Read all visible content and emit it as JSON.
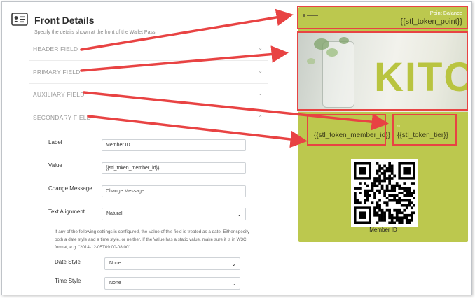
{
  "form": {
    "title": "Front Details",
    "subtitle": "Specify the details shown at the front of the Wallet Pass",
    "sections": [
      {
        "label": "HEADER FIELD",
        "state": "collapsed"
      },
      {
        "label": "PRIMARY FIELD",
        "state": "collapsed"
      },
      {
        "label": "AUXILIARY FIELD",
        "state": "collapsed"
      },
      {
        "label": "SECONDARY FIELD",
        "state": "expanded"
      }
    ],
    "secondary": {
      "label_label": "Label",
      "label_value": "Member ID",
      "value_label": "Value",
      "value_value": "{{stl_token_member_id}}",
      "change_message_label": "Change Message",
      "change_message_placeholder": "Change Message",
      "text_alignment_label": "Text Alignment",
      "text_alignment_value": "Natural",
      "note": "If any of the following settings is configured, the Value of this field is treated as a date. Either specify both a date style and a time style, or neither. If the Value has a static value, make sure it is in W3C format, e.g. \"2014-12-05T09:00-08:00\"",
      "date_style_label": "Date Style",
      "date_style_value": "None",
      "time_style_label": "Time Style",
      "time_style_value": "None"
    }
  },
  "pass": {
    "header_label": "Point Balance",
    "header_value": "{{stl_token_point}}",
    "strip_word": "KITC",
    "secondary_fields": [
      {
        "value": "{{stl_token_member_id}}"
      },
      {
        "label": "ier",
        "value": "{{stl_token_tier}}"
      }
    ],
    "barcode_caption": "Member ID"
  },
  "colors": {
    "pass_background": "#bcc84e",
    "annotation_red": "#e84343",
    "strip_text": "#b9c440"
  },
  "icons": {
    "form_header": "id-card-icon",
    "chevron_collapsed": "chevron-down-icon",
    "chevron_expanded": "chevron-up-icon"
  }
}
